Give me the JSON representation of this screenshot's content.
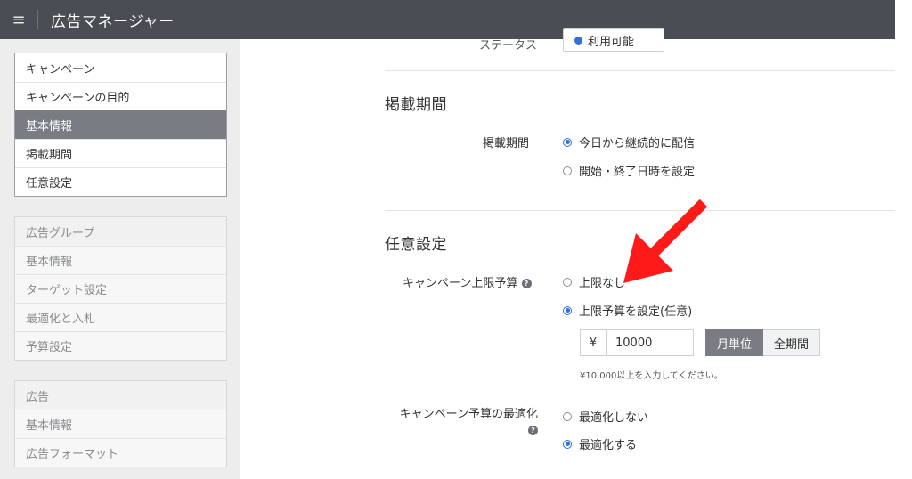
{
  "header": {
    "menu_icon": "hamburger-icon",
    "title": "広告マネージャー"
  },
  "sidebar": {
    "groups": [
      {
        "items": [
          "キャンペーン",
          "キャンペーンの目的",
          "基本情報",
          "掲載期間",
          "任意設定"
        ],
        "selected": "基本情報"
      },
      {
        "items": [
          "広告グループ",
          "基本情報",
          "ターゲット設定",
          "最適化と入札",
          "予算設定"
        ]
      },
      {
        "items": [
          "広告",
          "基本情報",
          "広告フォーマット"
        ]
      }
    ]
  },
  "main": {
    "cut_row": {
      "label": "ステータス",
      "value": "利用可能"
    },
    "schedule": {
      "title": "掲載期間",
      "field_label": "掲載期間",
      "options": [
        "今日から継続的に配信",
        "開始・終了日時を設定"
      ],
      "selected": "今日から継続的に配信"
    },
    "optional": {
      "title": "任意設定",
      "budget_label": "キャンペーン上限予算",
      "budget_help_icon": "question-circle-icon",
      "budget_options": [
        "上限なし",
        "上限予算を設定(任意)"
      ],
      "budget_selected": "上限予算を設定(任意)",
      "currency_symbol": "¥",
      "amount": "10000",
      "period_buttons": [
        "月単位",
        "全期間"
      ],
      "period_selected": "月単位",
      "hint": "¥10,000以上を入力してください。",
      "optimize_label": "キャンペーン予算の最適化",
      "optimize_help_icon": "question-circle-icon",
      "optimize_options": [
        "最適化しない",
        "最適化する"
      ],
      "optimize_selected": "最適化する"
    }
  },
  "annotation": {
    "icon": "red-arrow-icon",
    "color": "#ff1a1a"
  },
  "colors": {
    "header": "#4a4d53",
    "selected_nav": "#797c83",
    "radio_accent": "#2f6fe0"
  }
}
